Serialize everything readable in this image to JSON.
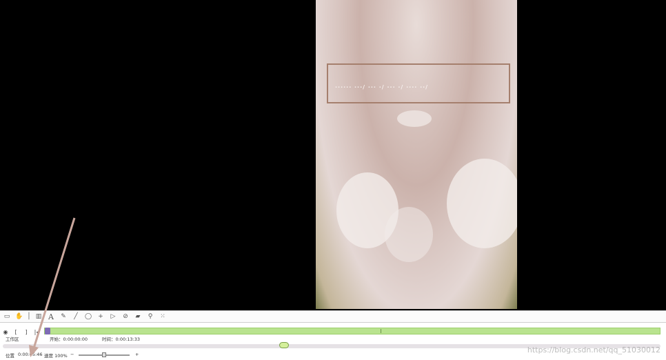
{
  "video": {
    "caption": "······ ···/ ··· ·/ ··· ·/ ···· ··/"
  },
  "toolbar": {
    "icons": [
      "new-icon",
      "hand-icon",
      "frame-icon",
      "text-icon",
      "pen-icon",
      "line-icon",
      "circle-icon",
      "plus-icon",
      "triangle-icon",
      "circle-slash-icon",
      "eraser-icon",
      "magnifier-icon",
      "grid-icon"
    ],
    "text_glyph": "A"
  },
  "timeline": {
    "workspace_label": "工作区",
    "start_label": "开始：0:00:00:00",
    "duration_label": "时间：0:00:13:33",
    "position_label": "位置",
    "position_value": "0:00:05:46",
    "speed_label": "速度 100%",
    "zoom_minus": "−",
    "zoom_plus": "+",
    "playhead_fraction": 0.42
  },
  "watermark": "https://blog.csdn.net/qq_51030012",
  "colors": {
    "track": "#b9e38f",
    "arrow": "#c8a69c",
    "caption_border": "#a57f6d"
  }
}
